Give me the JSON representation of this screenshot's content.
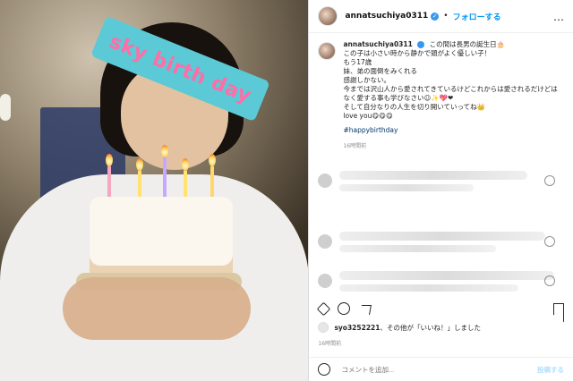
{
  "photo": {
    "overlay_text": "sky birth day"
  },
  "header": {
    "username": "annatsuchiya0311",
    "follow_label": "フォローする",
    "more_label": "…"
  },
  "caption": {
    "username": "annatsuchiya0311",
    "lines": [
      "この間は長男の誕生日🎂",
      "この子は小さい時から静かで頭がよく優しい子！",
      "もう17歳",
      "妹、弟の面倒をみくれる",
      "感謝しかない。",
      "今までは沢山人から愛されてきているけどこれからは愛されるだけどはなく愛する事も学びなさい☺︎✨💖❤",
      "そして自分なりの人生を切り開いていってね👑",
      "love you😋😋😋"
    ],
    "hashtag": "#happybirthday",
    "time_ago": "16時間前"
  },
  "likes": {
    "user": "syo3252221",
    "text_suffix": "、その他が「いいね！」しました",
    "time_ago": "16時間前"
  },
  "comment_box": {
    "placeholder": "コメントを追加...",
    "post_label": "投稿する"
  }
}
